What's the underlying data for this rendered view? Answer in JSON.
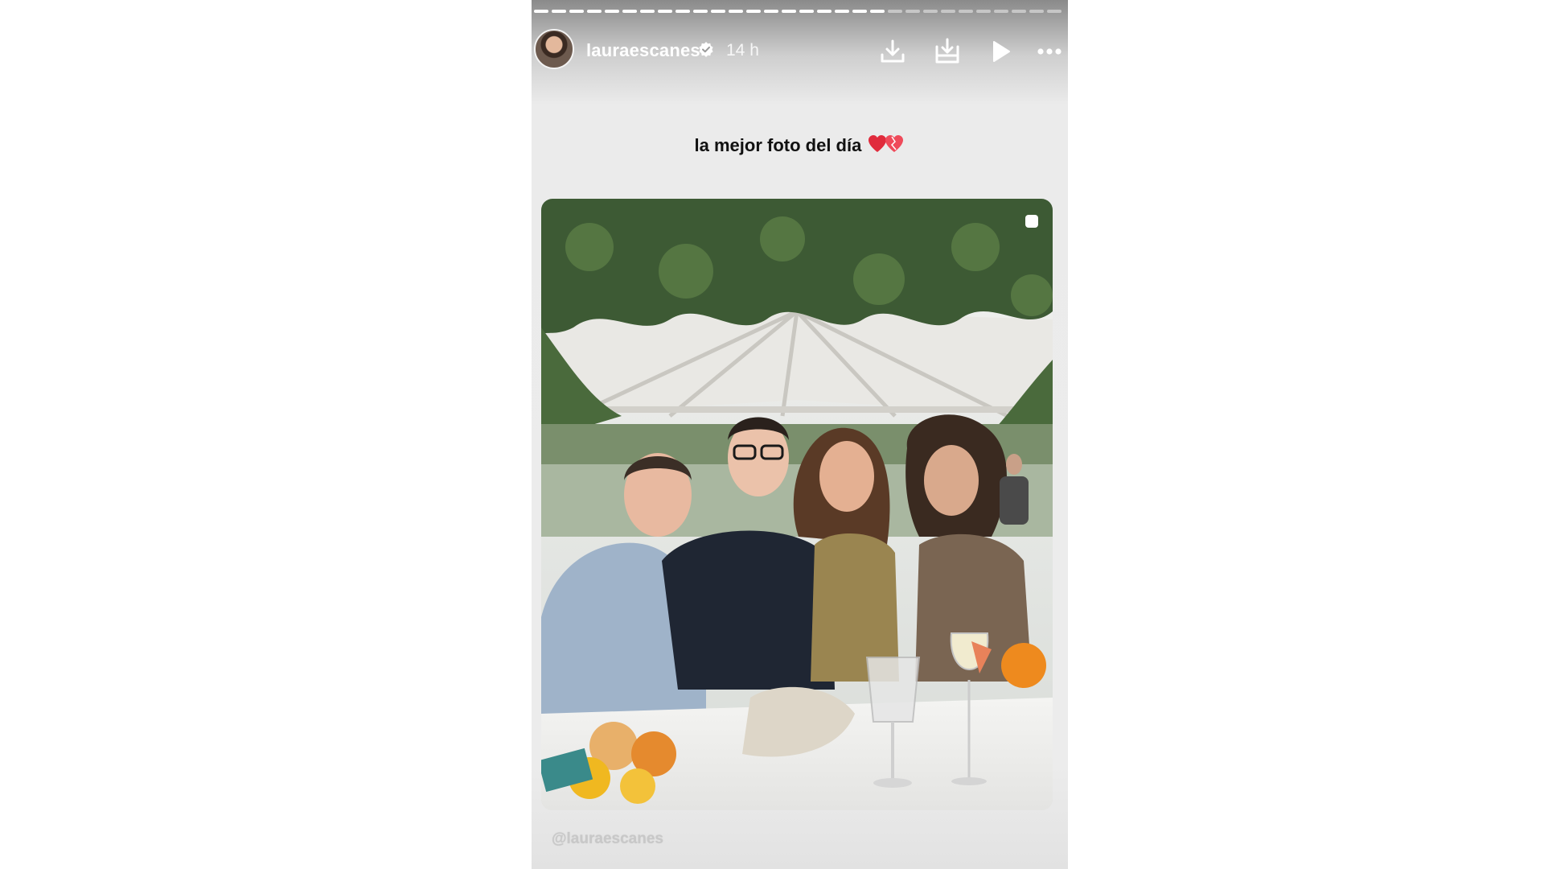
{
  "story": {
    "username": "lauraescanes",
    "time": "14 h",
    "verified": true,
    "caption": "la mejor foto del día",
    "caption_emoji": "heart-emoji",
    "watermark": "@lauraescanes",
    "progress_done_fraction": 0.68,
    "progress_segments": 30
  },
  "header": {
    "icons": [
      "download-icon",
      "save-to-device-icon",
      "play-icon",
      "more-options-icon"
    ]
  },
  "colors": {
    "text_white": "#ffffff",
    "caption_text": "#111111",
    "verified_badge": "#ffffff",
    "heart_red": "#e02b3c"
  }
}
